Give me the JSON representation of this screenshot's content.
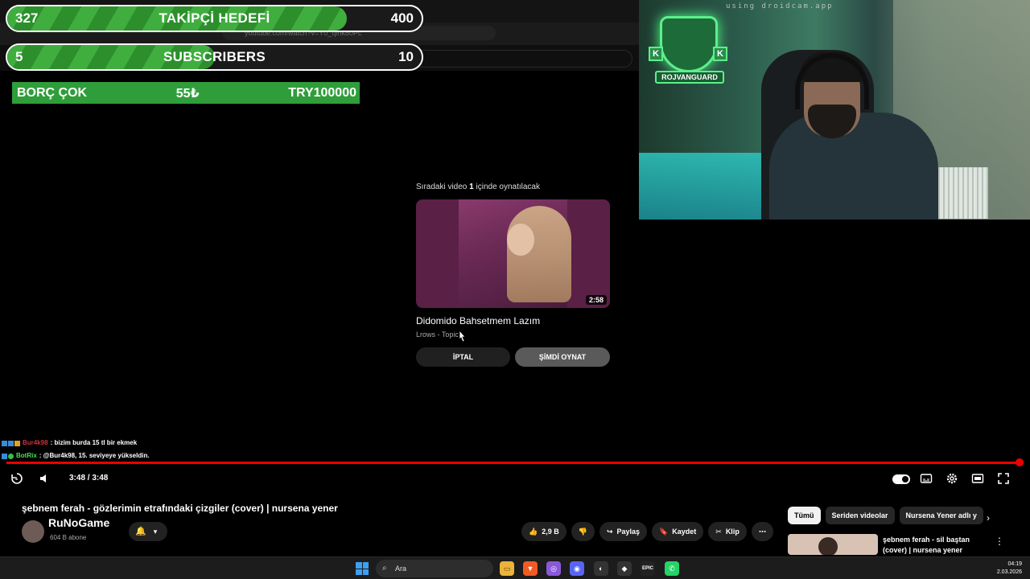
{
  "browser": {
    "address": "youtube.com/watch?v=Y0_qlhk80Pc",
    "search_placeholder": "Ara"
  },
  "goals": [
    {
      "current": "327",
      "title": "TAKİPÇİ HEDEFİ",
      "target": "400",
      "progress": 0.82
    },
    {
      "current": "5",
      "title": "SUBSCRIBERS",
      "target": "10",
      "progress": 0.5
    }
  ],
  "debt_bar": {
    "label": "BORÇ ÇOK",
    "amount": "55₺",
    "goal": "TRY100000"
  },
  "up_next": {
    "prefix": "Sıradaki video",
    "seconds": "1",
    "suffix": "içinde oynatılacak",
    "duration": "2:58",
    "title": "Didomido Bahsetmem Lazım",
    "channel": "Lrows - Topic",
    "cancel_label": "İPTAL",
    "play_now_label": "ŞİMDİ OYNAT"
  },
  "webcam": {
    "watermark": "using droidcam.app",
    "logo_text": "ROJVANGUARD",
    "logo_letter": "K"
  },
  "chat": [
    {
      "user": "Bur4k98",
      "message": ": bizim burda 15 tl bir ekmek",
      "color": "#c8333f"
    },
    {
      "user": "BotRix",
      "message": ": @Bur4k98, 15. seviyeye yükseldin.",
      "color": "#4fe05a"
    }
  ],
  "player": {
    "time": "3:48 / 3:48",
    "progress": 1.0
  },
  "video": {
    "title": "şebnem ferah - gözlerimin etrafındaki çizgiler (cover) | nursena yener",
    "channel_overlay": "RuNoGame",
    "subscribers": "604 B abone",
    "likes": "2,9 B",
    "share_label": "Paylaş",
    "save_label": "Kaydet",
    "clip_label": "Klip"
  },
  "chips": [
    "Tümü",
    "Seriden videolar",
    "Nursena Yener adlı y"
  ],
  "recommendation": {
    "title": "şebnem ferah - sil baştan (cover) | nursena yener"
  },
  "taskbar": {
    "search_label": "Ara",
    "time": "04:19",
    "date": "2.03.2026"
  }
}
